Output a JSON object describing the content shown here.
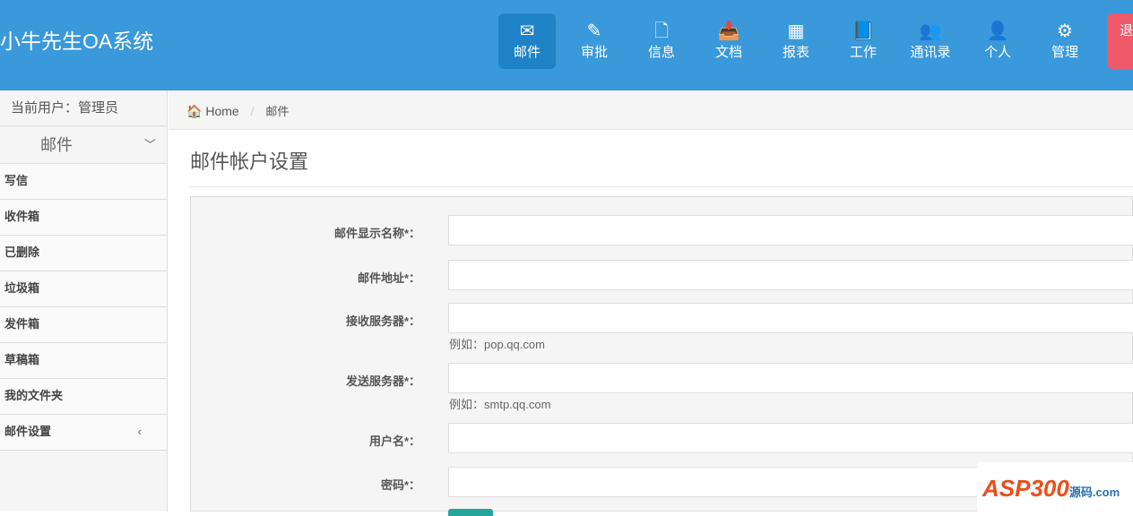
{
  "header": {
    "brand": "小牛先生OA系统",
    "logout": "退",
    "nav": [
      {
        "label": "邮件",
        "icon": "envelope-icon",
        "g": "✉"
      },
      {
        "label": "审批",
        "icon": "pencil-icon",
        "g": "✎"
      },
      {
        "label": "信息",
        "icon": "file-icon",
        "g": "🗋"
      },
      {
        "label": "文档",
        "icon": "inbox-icon",
        "g": "📥"
      },
      {
        "label": "报表",
        "icon": "table-icon",
        "g": "▦"
      },
      {
        "label": "工作",
        "icon": "book-icon",
        "g": "📘"
      },
      {
        "label": "通讯录",
        "icon": "users-icon",
        "g": "👥"
      },
      {
        "label": "个人",
        "icon": "user-icon",
        "g": "👤"
      },
      {
        "label": "管理",
        "icon": "gears-icon",
        "g": "⚙"
      }
    ]
  },
  "sidebar": {
    "user": "当前用户：管理员",
    "group": "邮件",
    "items": [
      "写信",
      "收件箱",
      "已删除",
      "垃圾箱",
      "发件箱",
      "草稿箱",
      "我的文件夹",
      "邮件设置"
    ]
  },
  "breadcrumb": {
    "home": "Home",
    "current": "邮件"
  },
  "page": {
    "title": "邮件帐户设置"
  },
  "form": {
    "fields": [
      {
        "label": "邮件显示名称*：",
        "value": ""
      },
      {
        "label": "邮件地址*：",
        "value": ""
      },
      {
        "label": "接收服务器*：",
        "value": "",
        "help": "例如：pop.qq.com"
      },
      {
        "label": "发送服务器*：",
        "value": "",
        "help": "例如：smtp.qq.com"
      },
      {
        "label": "用户名*：",
        "value": ""
      },
      {
        "label": "密码*：",
        "value": ""
      }
    ]
  },
  "watermark": {
    "text": "ASP300",
    "sub": "源码.com"
  }
}
